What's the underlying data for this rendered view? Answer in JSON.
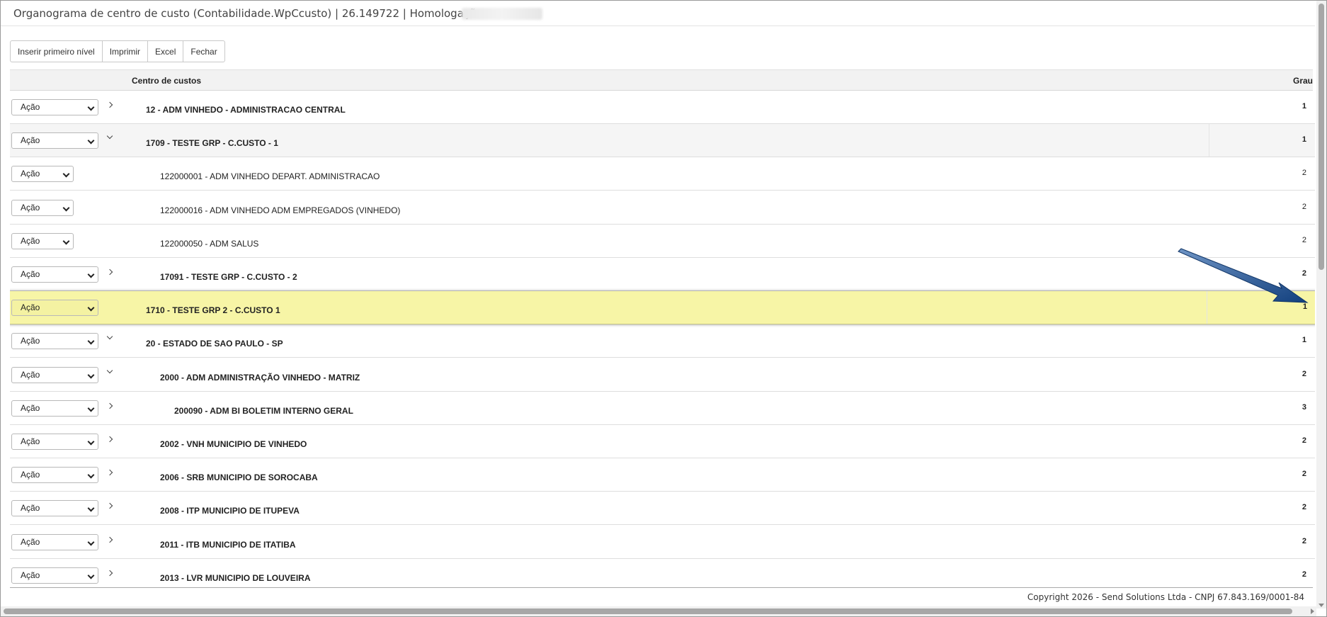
{
  "window": {
    "title": "Organograma de centro de custo (Contabilidade.WpCcusto) | 26.149722 | Homologação"
  },
  "toolbar": {
    "insert_label": "Inserir primeiro nível",
    "print_label": "Imprimir",
    "excel_label": "Excel",
    "close_label": "Fechar"
  },
  "grid": {
    "col_name": "Centro de custos",
    "col_grau": "Grau",
    "action_label": "Ação",
    "rows": [
      {
        "name": "12 - ADM VINHEDO - ADMINISTRACAO CENTRAL",
        "grau": "1",
        "level": 1,
        "bold": true,
        "toggle": "right",
        "shaded": false
      },
      {
        "name": "1709 - TESTE GRP - C.CUSTO - 1",
        "grau": "1",
        "level": 1,
        "bold": true,
        "toggle": "down",
        "shaded": true
      },
      {
        "name": "122000001 - ADM VINHEDO DEPART. ADMINISTRACAO",
        "grau": "2",
        "level": 2,
        "bold": false,
        "toggle": "none",
        "shaded": false
      },
      {
        "name": "122000016 - ADM VINHEDO ADM EMPREGADOS (VINHEDO)",
        "grau": "2",
        "level": 2,
        "bold": false,
        "toggle": "none",
        "shaded": false
      },
      {
        "name": "122000050 - ADM SALUS",
        "grau": "2",
        "level": 2,
        "bold": false,
        "toggle": "none",
        "shaded": false
      },
      {
        "name": "17091 - TESTE GRP - C.CUSTO - 2",
        "grau": "2",
        "level": 2,
        "bold": true,
        "toggle": "right",
        "shaded": false
      },
      {
        "name": "1710 - TESTE GRP 2 - C.CUSTO 1",
        "grau": "1",
        "level": 1,
        "bold": true,
        "toggle": "none",
        "shaded": false,
        "highlight": true
      },
      {
        "name": "20 - ESTADO DE SAO PAULO - SP",
        "grau": "1",
        "level": 1,
        "bold": true,
        "toggle": "down",
        "shaded": false
      },
      {
        "name": "2000 - ADM ADMINISTRAÇÃO VINHEDO - MATRIZ",
        "grau": "2",
        "level": 2,
        "bold": true,
        "toggle": "down",
        "shaded": false
      },
      {
        "name": "200090 - ADM BI BOLETIM INTERNO GERAL",
        "grau": "3",
        "level": 3,
        "bold": true,
        "toggle": "right",
        "shaded": false
      },
      {
        "name": "2002 - VNH MUNICIPIO DE VINHEDO",
        "grau": "2",
        "level": 2,
        "bold": true,
        "toggle": "right",
        "shaded": false
      },
      {
        "name": "2006 - SRB MUNICIPIO DE SOROCABA",
        "grau": "2",
        "level": 2,
        "bold": true,
        "toggle": "right",
        "shaded": false
      },
      {
        "name": "2008 - ITP MUNICIPIO DE ITUPEVA",
        "grau": "2",
        "level": 2,
        "bold": true,
        "toggle": "right",
        "shaded": false
      },
      {
        "name": "2011 - ITB MUNICIPIO DE ITATIBA",
        "grau": "2",
        "level": 2,
        "bold": true,
        "toggle": "right",
        "shaded": false
      },
      {
        "name": "2013 - LVR MUNICIPIO DE LOUVEIRA",
        "grau": "2",
        "level": 2,
        "bold": true,
        "toggle": "right",
        "shaded": false
      }
    ]
  },
  "footer": {
    "copyright": "Copyright 2026 - Send Solutions Ltda - CNPJ 67.843.169/0001-84"
  },
  "colors": {
    "highlight_row": "#f7f5a6",
    "arrow": "#1c4f8f"
  },
  "icons": {
    "collapsed": "chevron-right-icon",
    "expanded": "chevron-down-icon",
    "select": "select-caret-icon"
  }
}
